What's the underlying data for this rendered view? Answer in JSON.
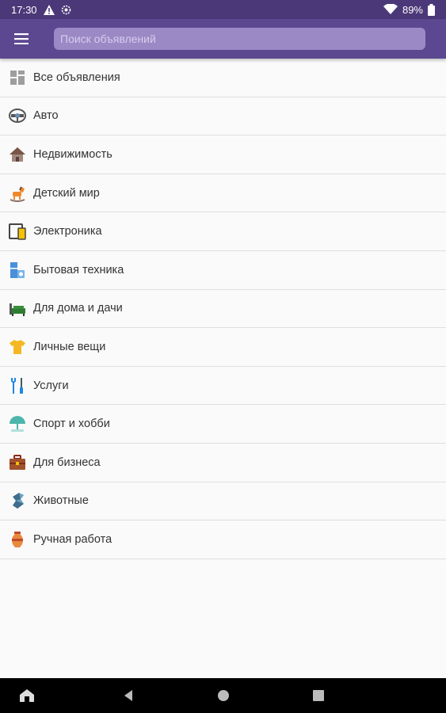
{
  "status_bar": {
    "time": "17:30",
    "battery": "89%",
    "icons": [
      "alert-icon",
      "settings-gear-icon",
      "wifi-icon",
      "battery-icon"
    ]
  },
  "toolbar": {
    "menu_icon": "hamburger-menu-icon",
    "search_placeholder": "Поиск объявлений",
    "background": "#5c4890"
  },
  "categories": [
    {
      "label": "Все объявления",
      "icon": "grid-icon"
    },
    {
      "label": "Авто",
      "icon": "steering-wheel-icon"
    },
    {
      "label": "Недвижимость",
      "icon": "house-icon"
    },
    {
      "label": "Детский мир",
      "icon": "rocking-horse-icon"
    },
    {
      "label": "Электроника",
      "icon": "devices-icon"
    },
    {
      "label": "Бытовая техника",
      "icon": "appliance-icon"
    },
    {
      "label": "Для дома и дачи",
      "icon": "sofa-icon"
    },
    {
      "label": "Личные вещи",
      "icon": "tshirt-icon"
    },
    {
      "label": "Услуги",
      "icon": "tools-icon"
    },
    {
      "label": "Спорт и хобби",
      "icon": "umbrella-icon"
    },
    {
      "label": "Для бизнеса",
      "icon": "briefcase-icon"
    },
    {
      "label": "Животные",
      "icon": "animal-icon"
    },
    {
      "label": "Ручная работа",
      "icon": "vase-icon"
    }
  ],
  "nav_bar": {
    "icons": [
      "app-switch-icon",
      "back-icon",
      "home-icon",
      "recents-icon"
    ]
  }
}
